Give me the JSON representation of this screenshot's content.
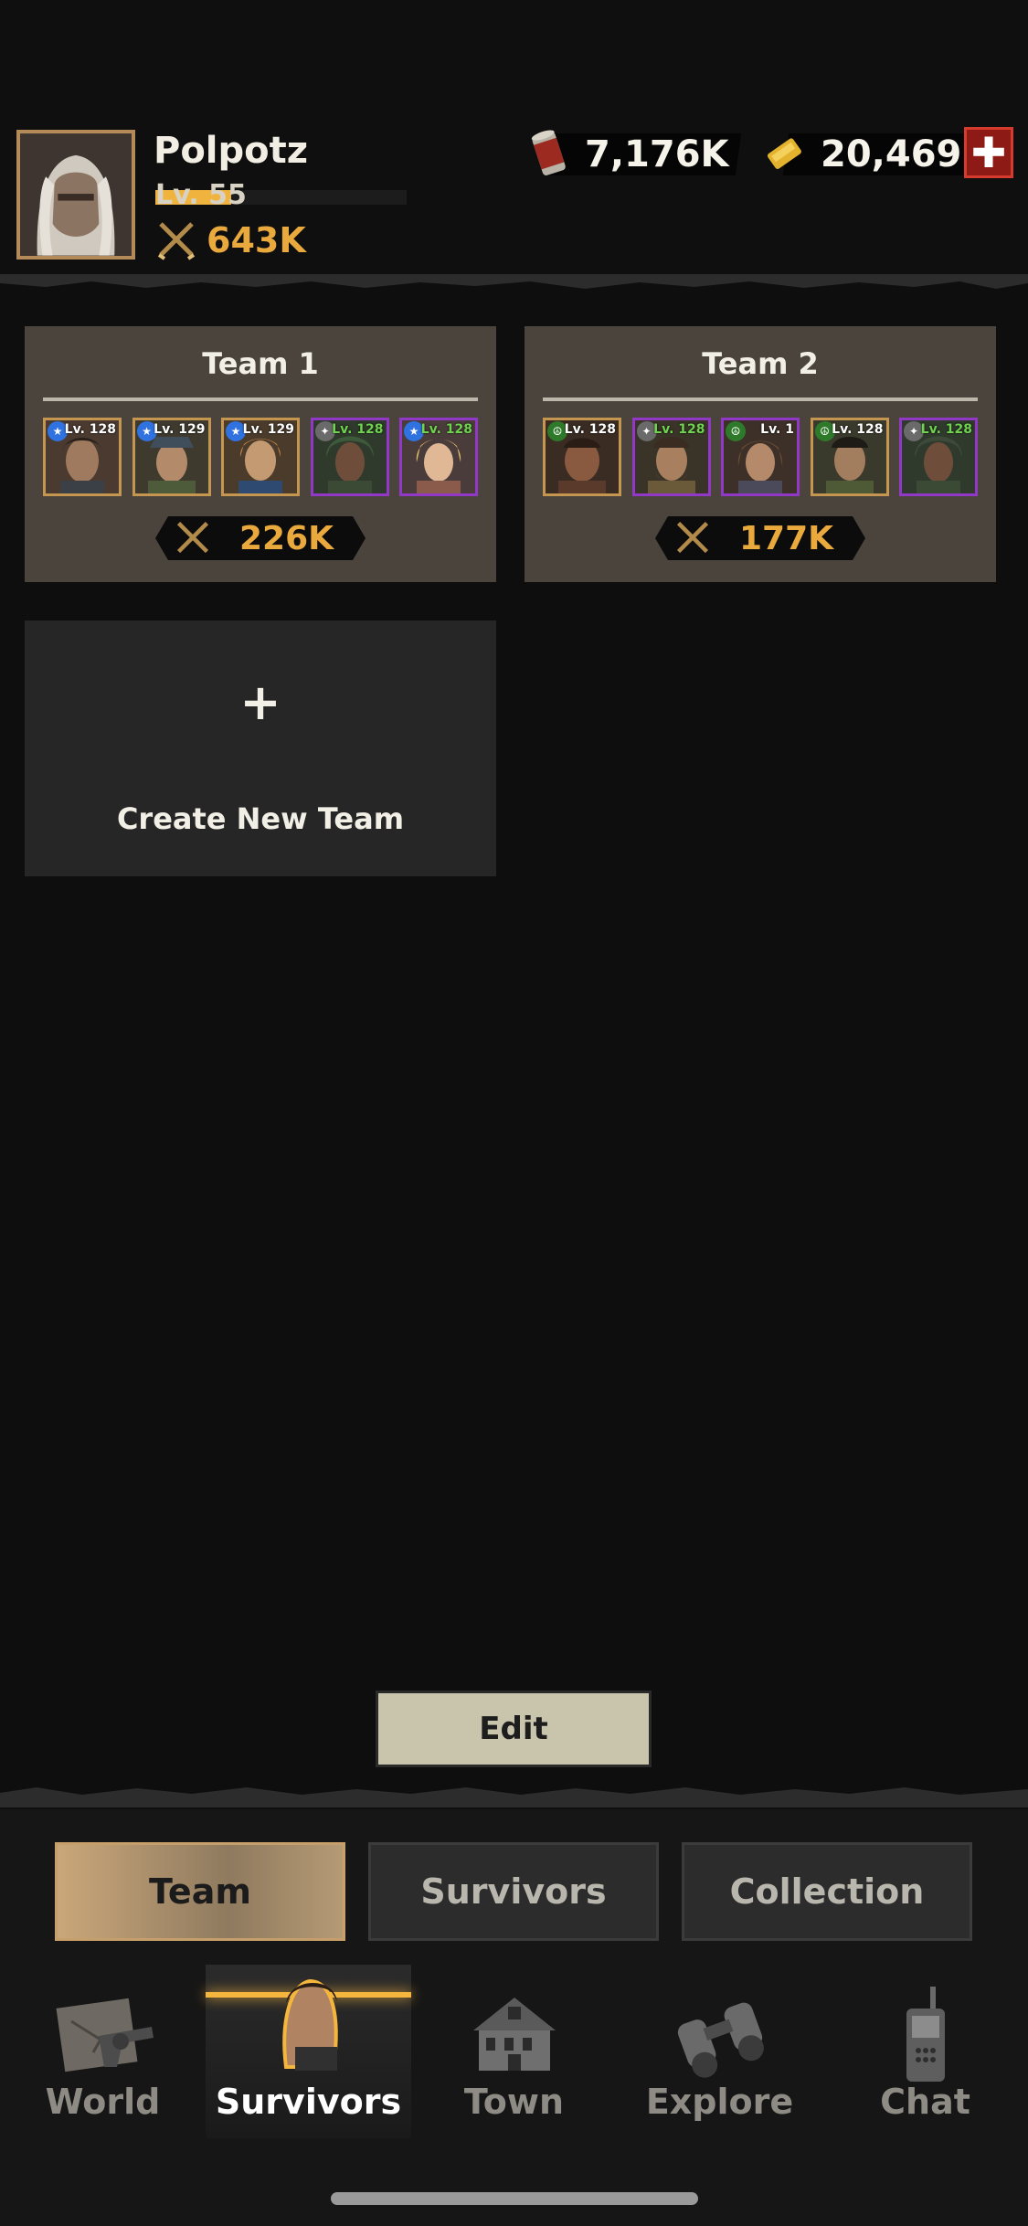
{
  "player": {
    "name": "Polpotz",
    "level_label": "Lv. 55",
    "level_progress": 0.3,
    "power": "643K"
  },
  "resources": [
    {
      "icon": "canned-food-icon",
      "value": "7,176K"
    },
    {
      "icon": "gold-bar-icon",
      "value": "20,469"
    }
  ],
  "teams": [
    {
      "title": "Team 1",
      "power": "226K",
      "members": [
        {
          "level": "Lv. 128",
          "badge": "blue",
          "frame": "gold",
          "level_color": "white"
        },
        {
          "level": "Lv. 129",
          "badge": "blue",
          "frame": "gold",
          "level_color": "white"
        },
        {
          "level": "Lv. 129",
          "badge": "blue",
          "frame": "gold",
          "level_color": "white"
        },
        {
          "level": "Lv. 128",
          "badge": "grey",
          "frame": "purple",
          "level_color": "green"
        },
        {
          "level": "Lv. 128",
          "badge": "blue",
          "frame": "purple",
          "level_color": "green"
        }
      ]
    },
    {
      "title": "Team 2",
      "power": "177K",
      "members": [
        {
          "level": "Lv. 128",
          "badge": "green",
          "frame": "gold",
          "level_color": "white"
        },
        {
          "level": "Lv. 128",
          "badge": "grey",
          "frame": "purple",
          "level_color": "green"
        },
        {
          "level": "Lv. 1",
          "badge": "green",
          "frame": "purple",
          "level_color": "white"
        },
        {
          "level": "Lv. 128",
          "badge": "green",
          "frame": "gold",
          "level_color": "white"
        },
        {
          "level": "Lv. 128",
          "badge": "grey",
          "frame": "purple",
          "level_color": "green"
        }
      ]
    }
  ],
  "create_team": {
    "plus": "+",
    "label": "Create New Team"
  },
  "edit_label": "Edit",
  "segments": [
    "Team",
    "Survivors",
    "Collection"
  ],
  "active_segment": "Team",
  "nav": [
    {
      "label": "World",
      "icon": "world-revolver-icon"
    },
    {
      "label": "Survivors",
      "icon": "survivor-portrait-icon"
    },
    {
      "label": "Town",
      "icon": "town-house-icon"
    },
    {
      "label": "Explore",
      "icon": "binoculars-icon"
    },
    {
      "label": "Chat",
      "icon": "walkie-talkie-icon"
    }
  ],
  "active_nav": "Survivors",
  "colors": {
    "accent": "#e9a93d",
    "purple_frame": "#9238c6",
    "gold_frame": "#c4964f",
    "alert_red": "#8e1a16"
  }
}
